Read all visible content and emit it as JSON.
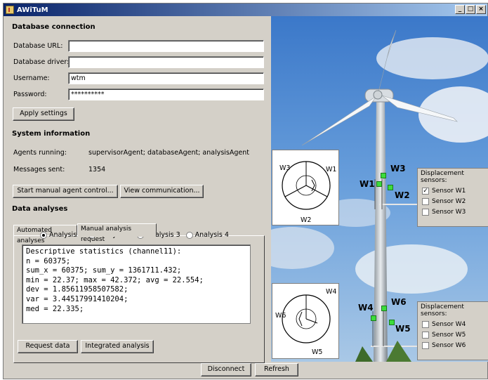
{
  "window": {
    "title": "AWiTuM",
    "controls": [
      "_",
      "□",
      "×"
    ]
  },
  "database": {
    "title": "Database connection",
    "url_label": "Database URL:",
    "url_value": "",
    "driver_label": "Database driver:",
    "driver_value": "",
    "username_label": "Username:",
    "username_value": "wtm",
    "password_label": "Password:",
    "password_value": "**********",
    "apply_button": "Apply settings"
  },
  "system": {
    "title": "System information",
    "agents_label": "Agents running:",
    "agents_value": "supervisorAgent; databaseAgent; analysisAgent",
    "messages_label": "Messages sent:",
    "messages_value": "1354",
    "start_button": "Start manual agent control...",
    "view_button": "View communication..."
  },
  "analyses": {
    "title": "Data analyses",
    "tabs": [
      "Automated analyses",
      "Manual analysis request"
    ],
    "active_tab": 1,
    "radios": [
      "Analysis 1",
      "Analysis 2",
      "Analysis 3",
      "Analysis 4"
    ],
    "selected_radio": 0,
    "output_lines": [
      "Descriptive statistics (channel11):",
      "n = 60375;",
      "sum_x = 60375; sum_y = 1361711.432;",
      "min = 22.37; max = 42.372; avg = 22.554;",
      "dev = 1.85611958507582;",
      "var = 3.44517991410204;",
      "med = 22.335;"
    ],
    "request_button": "Request data",
    "integrated_button": "Integrated analysis"
  },
  "sensors": {
    "upper": {
      "header": "Displacement sensors:",
      "items": [
        {
          "label": "Sensor W1",
          "checked": true
        },
        {
          "label": "Sensor W2",
          "checked": false
        },
        {
          "label": "Sensor W3",
          "checked": false
        }
      ],
      "diagram_labels": [
        "W3",
        "W1",
        "W2"
      ],
      "tower_labels": [
        "W3",
        "W1",
        "W2"
      ]
    },
    "lower": {
      "header": "Displacement sensors:",
      "items": [
        {
          "label": "Sensor W4",
          "checked": false
        },
        {
          "label": "Sensor W5",
          "checked": false
        },
        {
          "label": "Sensor W6",
          "checked": false
        }
      ],
      "diagram_labels": [
        "W4",
        "W6",
        "W5"
      ],
      "tower_labels": [
        "W6",
        "W4",
        "W5"
      ]
    }
  },
  "footer": {
    "disconnect_button": "Disconnect",
    "refresh_button": "Refresh"
  },
  "colors": {
    "title_start": "#0a246a",
    "title_end": "#a6caf0",
    "marker": "#3cdc3c",
    "sky": "#4a8ad8"
  }
}
